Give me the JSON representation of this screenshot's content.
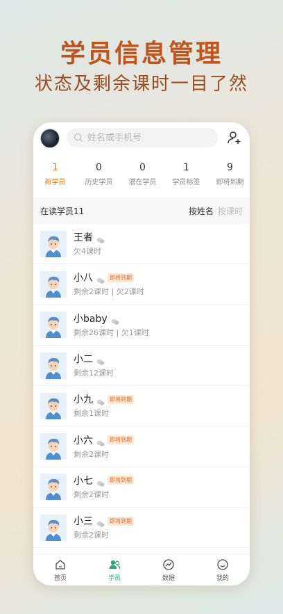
{
  "promo": {
    "title": "学员信息管理",
    "subtitle": "状态及剩余课时一目了然"
  },
  "search": {
    "placeholder": "姓名或手机号"
  },
  "stats": [
    {
      "num": "1",
      "label": "新学员",
      "active": true
    },
    {
      "num": "0",
      "label": "历史学员"
    },
    {
      "num": "0",
      "label": "潜在学员"
    },
    {
      "num": "1",
      "label": "学员标签"
    },
    {
      "num": "9",
      "label": "即将到期"
    }
  ],
  "list_header": {
    "title": "在读学员11",
    "sort_by_name": "按姓名",
    "sort_by_hours": "按课时"
  },
  "students": [
    {
      "name": "王者",
      "status": "欠4课时",
      "badge": ""
    },
    {
      "name": "小八",
      "status": "剩余2课时 | 欠2课时",
      "badge": "即将到期"
    },
    {
      "name": "小baby",
      "status": "剩余26课时 | 欠1课时",
      "badge": ""
    },
    {
      "name": "小二",
      "status": "剩余12课时",
      "badge": ""
    },
    {
      "name": "小九",
      "status": "剩余1课时",
      "badge": "即将到期"
    },
    {
      "name": "小六",
      "status": "剩余2课时",
      "badge": "即将到期"
    },
    {
      "name": "小七",
      "status": "剩余2课时",
      "badge": "即将到期"
    },
    {
      "name": "小三",
      "status": "剩余2课时",
      "badge": "即将到期"
    }
  ],
  "tabbar": [
    {
      "label": "首页",
      "icon": "home-icon"
    },
    {
      "label": "学员",
      "icon": "students-icon",
      "active": true
    },
    {
      "label": "数据",
      "icon": "chart-icon"
    },
    {
      "label": "我的",
      "icon": "profile-icon"
    }
  ],
  "colors": {
    "accent_orange": "#e07b1c",
    "promo_title": "#c0541b",
    "active_green": "#2aa879"
  }
}
